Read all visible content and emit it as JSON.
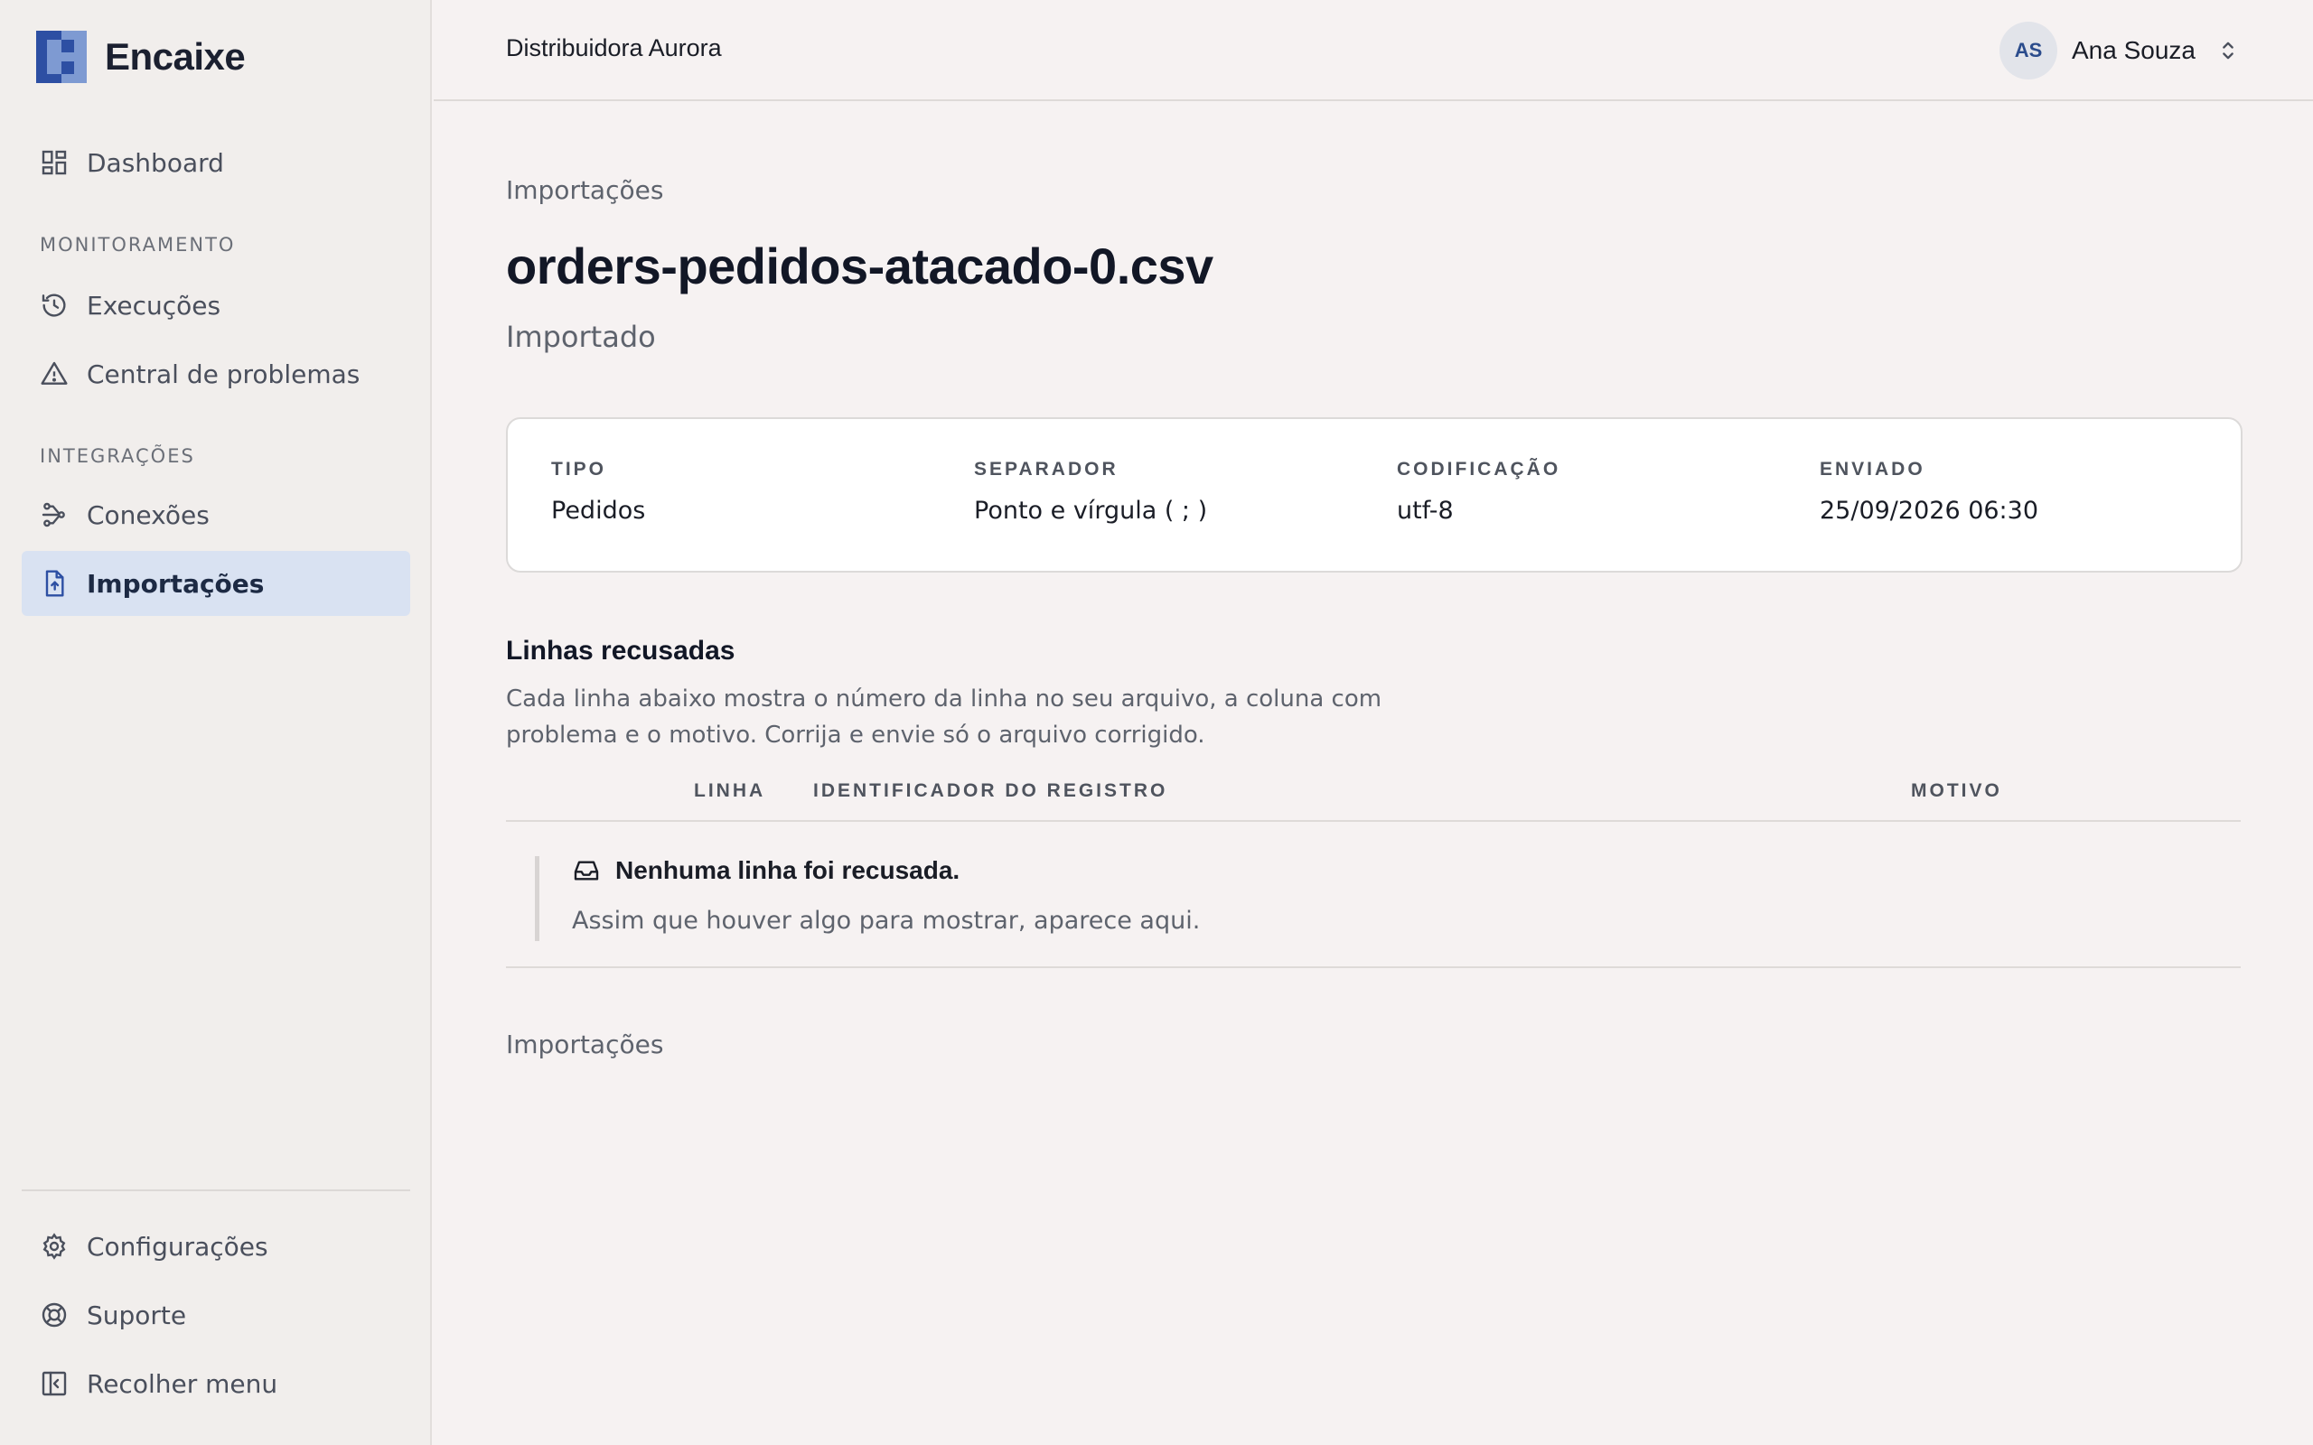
{
  "brand": {
    "name": "Encaixe"
  },
  "sidebar": {
    "items": [
      {
        "label": "Dashboard",
        "icon": "dashboard-grid-icon"
      },
      {
        "label": "Execuções",
        "icon": "history-icon"
      },
      {
        "label": "Central de problemas",
        "icon": "warning-triangle-icon"
      },
      {
        "label": "Conexões",
        "icon": "connections-icon"
      },
      {
        "label": "Importações",
        "icon": "file-upload-icon",
        "active": true
      }
    ],
    "sections": {
      "monitoring": "MONITORAMENTO",
      "integrations": "INTEGRAÇÕES"
    },
    "bottom_items": [
      {
        "label": "Configurações",
        "icon": "gear-icon"
      },
      {
        "label": "Suporte",
        "icon": "lifebuoy-icon"
      },
      {
        "label": "Recolher menu",
        "icon": "collapse-sidebar-icon"
      }
    ]
  },
  "topbar": {
    "org_name": "Distribuidora Aurora",
    "user": {
      "initials": "AS",
      "name": "Ana Souza"
    }
  },
  "main": {
    "breadcrumb": "Importações",
    "title": "orders-pedidos-atacado-0.csv",
    "status": "Importado",
    "meta": [
      {
        "key": "TIPO",
        "value": "Pedidos"
      },
      {
        "key": "SEPARADOR",
        "value": "Ponto e vírgula ( ; )"
      },
      {
        "key": "CODIFICAÇÃO",
        "value": "utf-8"
      },
      {
        "key": "ENVIADO",
        "value": "25/09/2026 06:30"
      }
    ],
    "rejected": {
      "title": "Linhas recusadas",
      "description": "Cada linha abaixo mostra o número da linha no seu arquivo, a coluna com problema e o motivo. Corrija e envie só o arquivo corrigido.",
      "columns": [
        "LINHA",
        "IDENTIFICADOR DO REGISTRO",
        "MOTIVO"
      ],
      "empty_title": "Nenhuma linha foi recusada.",
      "empty_subtitle": "Assim que houver algo para mostrar, aparece aqui."
    },
    "footer_link": "Importações"
  },
  "colors": {
    "accent": "#2d4fa3",
    "active_bg": "#d9e2f2",
    "page_bg": "#f6f2f2",
    "sidebar_bg": "#f1eeec"
  }
}
